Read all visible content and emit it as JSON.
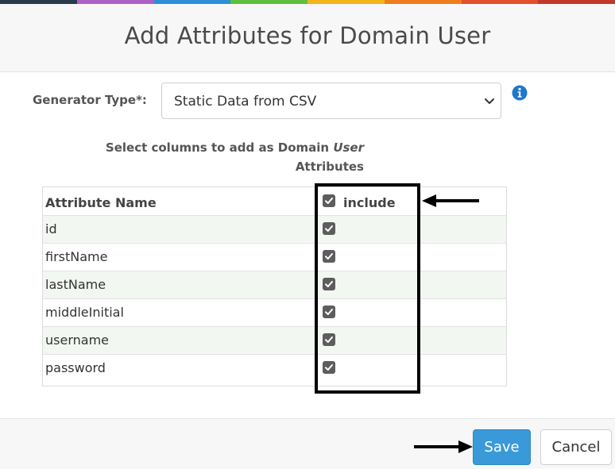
{
  "colors": {
    "top_bar": [
      "#2a3a4a",
      "#b05fc6",
      "#2d8fd5",
      "#5dbf3a",
      "#f2b51c",
      "#ef7d1d",
      "#e2502c",
      "#c0392b"
    ],
    "primary_button": "#3a9ad9",
    "info_icon": "#1f78c8"
  },
  "dialog": {
    "title": "Add Attributes for Domain User"
  },
  "generator": {
    "label": "Generator Type*:",
    "selected": "Static Data from CSV",
    "info_icon": "info-icon"
  },
  "columns": {
    "instruction_line1": "Select columns to add as Domain User",
    "instruction_line1_prefix": "Select columns to add as Domain ",
    "instruction_line1_italic": "User",
    "instruction_line2": "Attributes",
    "header": {
      "name": "Attribute Name",
      "include": "include",
      "include_all_checked": true
    },
    "rows": [
      {
        "name": "id",
        "checked": true
      },
      {
        "name": "firstName",
        "checked": true
      },
      {
        "name": "lastName",
        "checked": true
      },
      {
        "name": "middleInitial",
        "checked": true
      },
      {
        "name": "username",
        "checked": true
      },
      {
        "name": "password",
        "checked": true
      }
    ]
  },
  "footer": {
    "save_label": "Save",
    "cancel_label": "Cancel"
  }
}
